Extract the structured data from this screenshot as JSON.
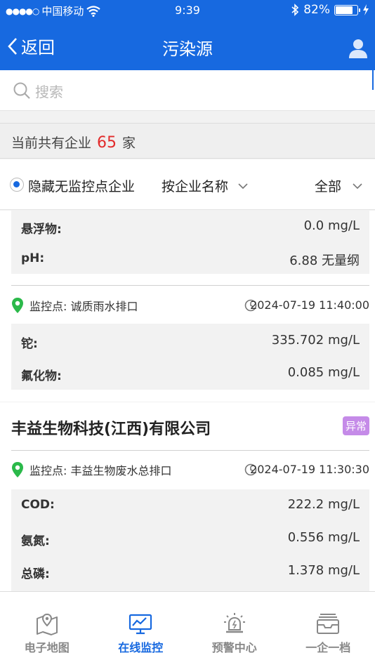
{
  "status_bar": {
    "signal_dots": "●●●●○",
    "carrier": "中国移动",
    "time": "9:39",
    "battery_percent": "82%",
    "battery_level": 0.82
  },
  "nav": {
    "back_label": "返回",
    "title": "污染源"
  },
  "search": {
    "placeholder": "搜索"
  },
  "summary": {
    "prefix": "当前共有企业",
    "count": "65",
    "suffix": "家"
  },
  "filters": {
    "hide_label": "隐藏无监控点企业",
    "sort_label": "按企业名称",
    "status_label": "全部"
  },
  "list": {
    "partial_metrics": [
      {
        "name": "悬浮物:",
        "value": "0.0 mg/L"
      },
      {
        "name": "pH:",
        "value": "6.88 无量纲"
      }
    ],
    "point1": {
      "label": "监控点: 诚质雨水排口",
      "time": "2024-07-19 11:40:00",
      "metrics": [
        {
          "name": "铊:",
          "value": "335.702 mg/L"
        },
        {
          "name": "氟化物:",
          "value": "0.085 mg/L"
        }
      ]
    },
    "company2": {
      "name": "丰益生物科技(江西)有限公司",
      "badge": "异常",
      "badge_color": "#c58be8",
      "point": {
        "label": "监控点: 丰益生物废水总排口",
        "time": "2024-07-19 11:30:30",
        "metrics": [
          {
            "name": "COD:",
            "value": "222.2 mg/L"
          },
          {
            "name": "氨氮:",
            "value": "0.556 mg/L"
          },
          {
            "name": "总磷:",
            "value": "1.378 mg/L"
          }
        ]
      }
    }
  },
  "tabs": [
    {
      "label": "电子地图",
      "icon": "map-icon",
      "active": false
    },
    {
      "label": "在线监控",
      "icon": "monitor-icon",
      "active": true
    },
    {
      "label": "预警中心",
      "icon": "alarm-icon",
      "active": false
    },
    {
      "label": "一企一档",
      "icon": "archive-icon",
      "active": false
    }
  ],
  "colors": {
    "primary": "#1769e0",
    "count_red": "#e22b2b",
    "pin_green": "#2bb94a"
  }
}
